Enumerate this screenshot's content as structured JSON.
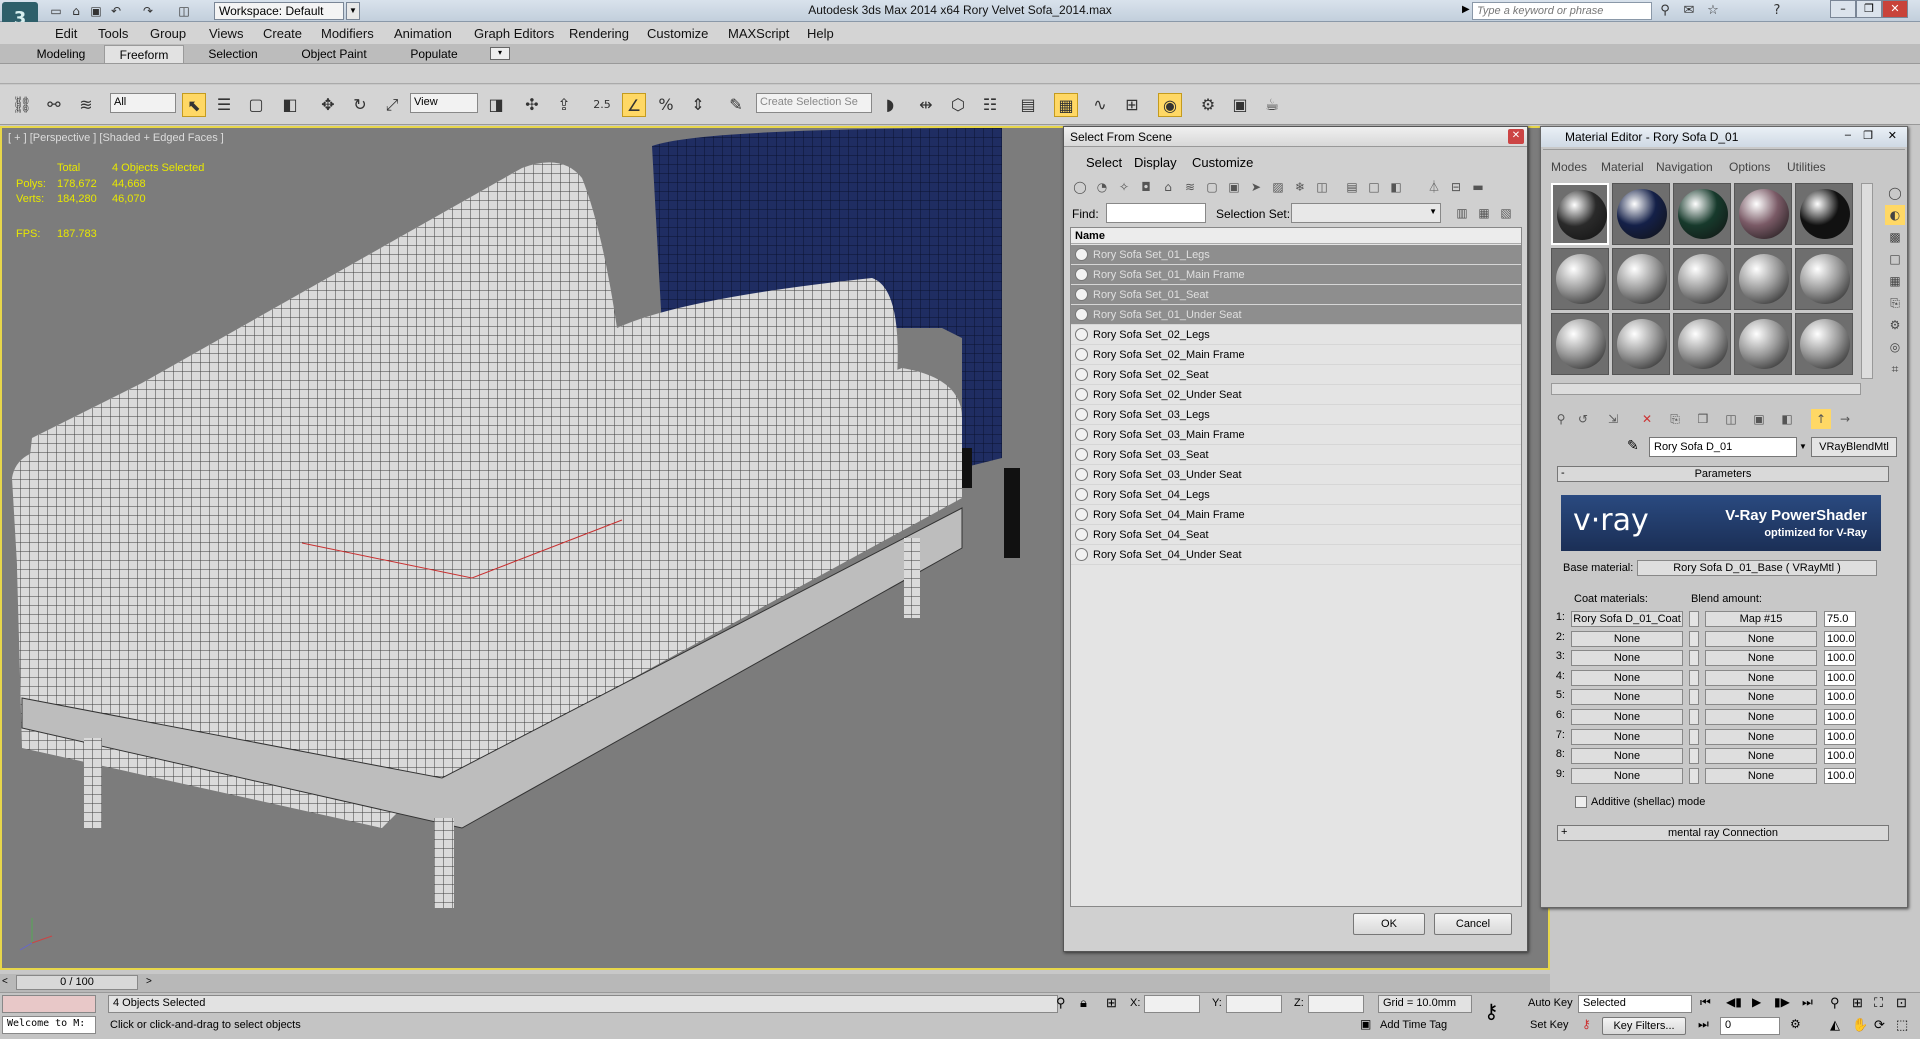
{
  "title_bar": {
    "workspace": "Workspace: Default",
    "app_title": "Autodesk 3ds Max  2014 x64      Rory Velvet Sofa_2014.max",
    "search_placeholder": "Type a keyword or phrase"
  },
  "menu": [
    "Edit",
    "Tools",
    "Group",
    "Views",
    "Create",
    "Modifiers",
    "Animation",
    "Graph Editors",
    "Rendering",
    "Customize",
    "MAXScript",
    "Help"
  ],
  "ribbon_tabs": [
    "Modeling",
    "Freeform",
    "Selection",
    "Object Paint",
    "Populate"
  ],
  "toolbar": {
    "filter": "All",
    "ref_coord": "View",
    "angle_snap": "2.5",
    "selection_set_placeholder": "Create Selection Se"
  },
  "viewport": {
    "label": "[ + ] [Perspective ] [Shaded + Edged Faces ]",
    "stats": {
      "total_label": "Total",
      "selected_label": "4 Objects Selected",
      "polys_label": "Polys:",
      "polys_total": "178,672",
      "polys_sel": "44,668",
      "verts_label": "Verts:",
      "verts_total": "184,280",
      "verts_sel": "46,070",
      "fps_label": "FPS:",
      "fps": "187.783"
    },
    "sofa_colors": {
      "white_sofa": "#e8e8e8",
      "blue_sofa": "#1e2b5c",
      "background": "#7c7c7c"
    }
  },
  "select_from_scene": {
    "title": "Select From Scene",
    "menus": [
      "Select",
      "Display",
      "Customize"
    ],
    "find_label": "Find:",
    "selection_set_label": "Selection Set:",
    "column_name": "Name",
    "items": [
      {
        "name": "Rory Sofa Set_01_Legs",
        "selected": true
      },
      {
        "name": "Rory Sofa Set_01_Main Frame",
        "selected": true
      },
      {
        "name": "Rory Sofa Set_01_Seat",
        "selected": true
      },
      {
        "name": "Rory Sofa Set_01_Under Seat",
        "selected": true
      },
      {
        "name": "Rory Sofa Set_02_Legs",
        "selected": false
      },
      {
        "name": "Rory Sofa Set_02_Main Frame",
        "selected": false
      },
      {
        "name": "Rory Sofa Set_02_Seat",
        "selected": false
      },
      {
        "name": "Rory Sofa Set_02_Under Seat",
        "selected": false
      },
      {
        "name": "Rory Sofa Set_03_Legs",
        "selected": false
      },
      {
        "name": "Rory Sofa Set_03_Main Frame",
        "selected": false
      },
      {
        "name": "Rory Sofa Set_03_Seat",
        "selected": false
      },
      {
        "name": "Rory Sofa Set_03_Under Seat",
        "selected": false
      },
      {
        "name": "Rory Sofa Set_04_Legs",
        "selected": false
      },
      {
        "name": "Rory Sofa Set_04_Main Frame",
        "selected": false
      },
      {
        "name": "Rory Sofa Set_04_Seat",
        "selected": false
      },
      {
        "name": "Rory Sofa Set_04_Under Seat",
        "selected": false
      }
    ],
    "ok_label": "OK",
    "cancel_label": "Cancel"
  },
  "material_editor": {
    "title": "Material Editor - Rory Sofa D_01",
    "menus": [
      "Modes",
      "Material",
      "Navigation",
      "Options",
      "Utilities"
    ],
    "slot_colors": [
      "#2a2a2a",
      "#142048",
      "#173a2c",
      "#7a5a66",
      "#111111",
      "#9a9a9a",
      "#9a9a9a",
      "#9a9a9a",
      "#9a9a9a",
      "#9a9a9a",
      "#9a9a9a",
      "#9a9a9a",
      "#9a9a9a",
      "#9a9a9a",
      "#9a9a9a"
    ],
    "material_name": "Rory Sofa D_01",
    "material_type": "VRayBlendMtl",
    "parameters_label": "Parameters",
    "banner_logo": "v·ray",
    "banner_title": "V-Ray PowerShader",
    "banner_subtitle": "optimized for V-Ray",
    "base_material_label": "Base material:",
    "base_material": "Rory Sofa D_01_Base  ( VRayMtl )",
    "coat_label": "Coat materials:",
    "blend_label": "Blend amount:",
    "coats": [
      {
        "idx": "1:",
        "coat": "Rory Sofa D_01_Coat",
        "map": "Map #15",
        "amount": "75.0"
      },
      {
        "idx": "2:",
        "coat": "None",
        "map": "None",
        "amount": "100.0"
      },
      {
        "idx": "3:",
        "coat": "None",
        "map": "None",
        "amount": "100.0"
      },
      {
        "idx": "4:",
        "coat": "None",
        "map": "None",
        "amount": "100.0"
      },
      {
        "idx": "5:",
        "coat": "None",
        "map": "None",
        "amount": "100.0"
      },
      {
        "idx": "6:",
        "coat": "None",
        "map": "None",
        "amount": "100.0"
      },
      {
        "idx": "7:",
        "coat": "None",
        "map": "None",
        "amount": "100.0"
      },
      {
        "idx": "8:",
        "coat": "None",
        "map": "None",
        "amount": "100.0"
      },
      {
        "idx": "9:",
        "coat": "None",
        "map": "None",
        "amount": "100.0"
      }
    ],
    "additive_label": "Additive (shellac) mode",
    "mr_connection": "mental ray Connection"
  },
  "timeline": {
    "frame": "0 / 100"
  },
  "status": {
    "maxscript": "Welcome to M:",
    "selected": "4 Objects Selected",
    "prompt": "Click or click-and-drag to select objects",
    "x_label": "X:",
    "y_label": "Y:",
    "z_label": "Z:",
    "grid": "Grid = 10.0mm",
    "add_time_tag": "Add Time Tag",
    "auto_key": "Auto Key",
    "set_key": "Set Key",
    "key_mode": "Selected",
    "key_filters": "Key Filters...",
    "current_frame": "0"
  }
}
